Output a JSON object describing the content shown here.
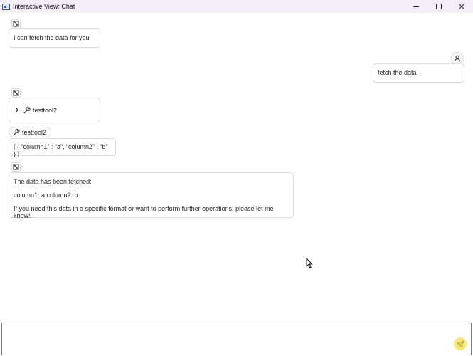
{
  "window": {
    "title": "Interactive View: Chat"
  },
  "messages": {
    "bot_1": "I can fetch the data for you",
    "user_1": "fetch the data",
    "tool_call_name": "testtool2",
    "tool_result_name": "testtool2",
    "tool_result_value": "[ { “column1” : “a”, “column2” : “b” } ]",
    "bot_2_line_1": "The data has been fetched:",
    "bot_2_line_2": "column1: a column2: b",
    "bot_2_line_3": "If you need this data in a specific format or want to perform further operations, please let me know!"
  },
  "input": {
    "value": ""
  },
  "icons": {
    "bot": "bot-icon",
    "user": "user-icon",
    "tool": "wrench-icon",
    "expand": "chevron-right-icon",
    "send": "send-icon"
  },
  "colors": {
    "titlebar": "#f3eef8",
    "send_button": "#f7e778",
    "border": "#dcdcdc"
  }
}
